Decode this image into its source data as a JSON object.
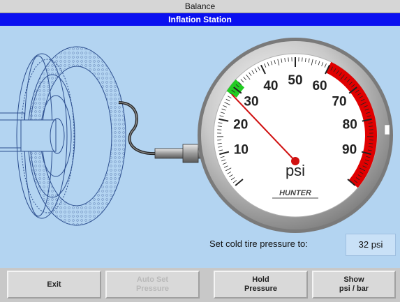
{
  "window": {
    "title": "Balance"
  },
  "screen": {
    "title": "Inflation Station"
  },
  "gauge": {
    "unit": "psi",
    "ticks": [
      "10",
      "20",
      "30",
      "40",
      "50",
      "60",
      "70",
      "80",
      "90"
    ],
    "needle_value": 28,
    "target_band": [
      28,
      32
    ],
    "danger_band": [
      60,
      100
    ],
    "brand": "HUNTER",
    "colors": {
      "needle": "#d01010",
      "target": "#22cc22",
      "danger": "#e00000"
    }
  },
  "setpoint": {
    "label": "Set cold tire pressure to:",
    "value": "32 psi"
  },
  "toolbar": {
    "exit_label": "Exit",
    "auto_set_label": "Auto Set\nPressure",
    "hold_label": "Hold\nPressure",
    "show_units_label": "Show\npsi / bar"
  },
  "icons": {
    "tire": "tire-outline-icon",
    "hose": "air-hose-icon",
    "gauge": "pressure-gauge-icon"
  }
}
